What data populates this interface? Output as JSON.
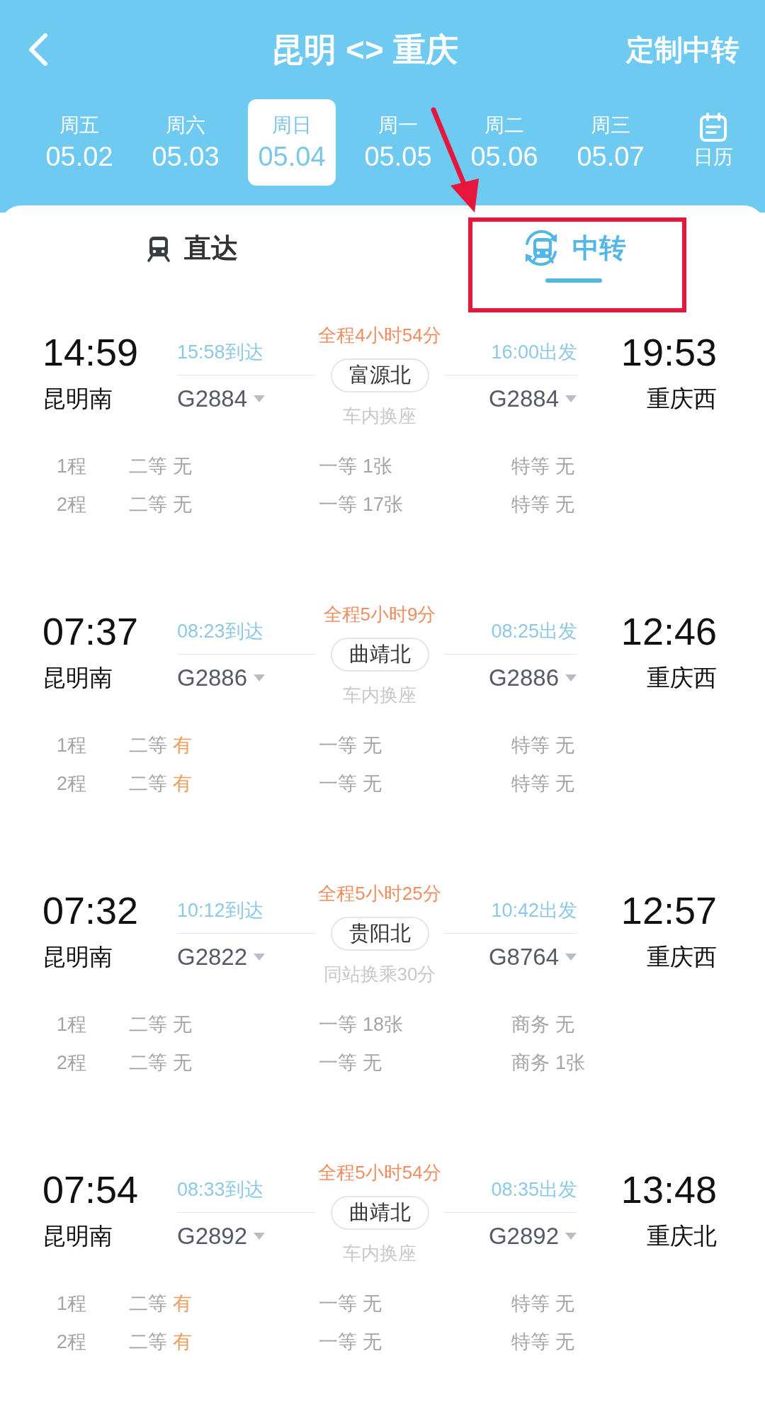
{
  "header": {
    "title": "昆明 <> 重庆",
    "action": "定制中转"
  },
  "dates": [
    {
      "weekday": "周五",
      "date": "05.02",
      "selected": false
    },
    {
      "weekday": "周六",
      "date": "05.03",
      "selected": false
    },
    {
      "weekday": "周日",
      "date": "05.04",
      "selected": true
    },
    {
      "weekday": "周一",
      "date": "05.05",
      "selected": false
    },
    {
      "weekday": "周二",
      "date": "05.06",
      "selected": false
    },
    {
      "weekday": "周三",
      "date": "05.07",
      "selected": false
    }
  ],
  "calendar": {
    "label": "日历"
  },
  "tabs": [
    {
      "label": "直达",
      "kind": "direct",
      "selected": false
    },
    {
      "label": "中转",
      "kind": "transfer",
      "selected": true
    }
  ],
  "trips": [
    {
      "depart_time": "14:59",
      "depart_station": "昆明南",
      "leg1_arrive": "15:58到达",
      "leg1_train": "G2884",
      "duration": "全程4小时54分",
      "transfer_station": "富源北",
      "transfer_note": "车内换座",
      "leg2_depart": "16:00出发",
      "leg2_train": "G2884",
      "arrive_time": "19:53",
      "arrive_station": "重庆西",
      "seats": [
        {
          "leg": "1程",
          "classes": [
            {
              "name": "二等",
              "status": "无",
              "highlighted": false
            },
            {
              "name": "一等",
              "status": "1张",
              "highlighted": false
            },
            {
              "name": "特等",
              "status": "无",
              "highlighted": false
            }
          ]
        },
        {
          "leg": "2程",
          "classes": [
            {
              "name": "二等",
              "status": "无",
              "highlighted": false
            },
            {
              "name": "一等",
              "status": "17张",
              "highlighted": false
            },
            {
              "name": "特等",
              "status": "无",
              "highlighted": false
            }
          ]
        }
      ]
    },
    {
      "depart_time": "07:37",
      "depart_station": "昆明南",
      "leg1_arrive": "08:23到达",
      "leg1_train": "G2886",
      "duration": "全程5小时9分",
      "transfer_station": "曲靖北",
      "transfer_note": "车内换座",
      "leg2_depart": "08:25出发",
      "leg2_train": "G2886",
      "arrive_time": "12:46",
      "arrive_station": "重庆西",
      "seats": [
        {
          "leg": "1程",
          "classes": [
            {
              "name": "二等",
              "status": "有",
              "highlighted": true
            },
            {
              "name": "一等",
              "status": "无",
              "highlighted": false
            },
            {
              "name": "特等",
              "status": "无",
              "highlighted": false
            }
          ]
        },
        {
          "leg": "2程",
          "classes": [
            {
              "name": "二等",
              "status": "有",
              "highlighted": true
            },
            {
              "name": "一等",
              "status": "无",
              "highlighted": false
            },
            {
              "name": "特等",
              "status": "无",
              "highlighted": false
            }
          ]
        }
      ]
    },
    {
      "depart_time": "07:32",
      "depart_station": "昆明南",
      "leg1_arrive": "10:12到达",
      "leg1_train": "G2822",
      "duration": "全程5小时25分",
      "transfer_station": "贵阳北",
      "transfer_note": "同站换乘30分",
      "leg2_depart": "10:42出发",
      "leg2_train": "G8764",
      "arrive_time": "12:57",
      "arrive_station": "重庆西",
      "seats": [
        {
          "leg": "1程",
          "classes": [
            {
              "name": "二等",
              "status": "无",
              "highlighted": false
            },
            {
              "name": "一等",
              "status": "18张",
              "highlighted": false
            },
            {
              "name": "商务",
              "status": "无",
              "highlighted": false
            }
          ]
        },
        {
          "leg": "2程",
          "classes": [
            {
              "name": "二等",
              "status": "无",
              "highlighted": false
            },
            {
              "name": "一等",
              "status": "无",
              "highlighted": false
            },
            {
              "name": "商务",
              "status": "1张",
              "highlighted": false
            }
          ]
        }
      ]
    },
    {
      "depart_time": "07:54",
      "depart_station": "昆明南",
      "leg1_arrive": "08:33到达",
      "leg1_train": "G2892",
      "duration": "全程5小时54分",
      "transfer_station": "曲靖北",
      "transfer_note": "车内换座",
      "leg2_depart": "08:35出发",
      "leg2_train": "G2892",
      "arrive_time": "13:48",
      "arrive_station": "重庆北",
      "seats": [
        {
          "leg": "1程",
          "classes": [
            {
              "name": "二等",
              "status": "有",
              "highlighted": true
            },
            {
              "name": "一等",
              "status": "无",
              "highlighted": false
            },
            {
              "name": "特等",
              "status": "无",
              "highlighted": false
            }
          ]
        },
        {
          "leg": "2程",
          "classes": [
            {
              "name": "二等",
              "status": "有",
              "highlighted": true
            },
            {
              "name": "一等",
              "status": "无",
              "highlighted": false
            },
            {
              "name": "特等",
              "status": "无",
              "highlighted": false
            }
          ]
        }
      ]
    }
  ]
}
